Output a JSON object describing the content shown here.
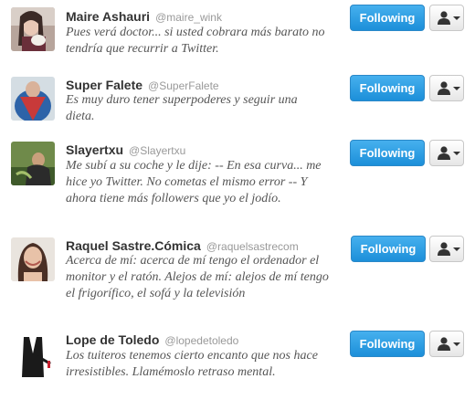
{
  "follow_label": "Following",
  "users": [
    {
      "name": "Maire Ashauri",
      "handle": "@maire_wink",
      "bio": "Pues verá doctor... si usted cobrara más barato no tendría que recurrir a Twitter."
    },
    {
      "name": "Super Falete",
      "handle": "@SuperFalete",
      "bio": "Es muy duro tener superpoderes y seguir una dieta."
    },
    {
      "name": "Slayertxu",
      "handle": "@Slayertxu",
      "bio": "Me subí a su coche y le dije: -- En esa curva... me hice yo Twitter. No cometas el mismo error -- Y ahora tiene más followers que yo el jodío."
    },
    {
      "name": "Raquel Sastre.Cómica",
      "handle": "@raquelsastrecom",
      "bio": "Acerca de mí: acerca de mí tengo el ordenador el monitor y el ratón. Alejos de mí: alejos de mí tengo el frigorífico, el sofá y la televisión"
    },
    {
      "name": "Lope de Toledo",
      "handle": "@lopedetoledo",
      "bio": "Los tuiteros tenemos cierto encanto que nos hace irresistibles. Llamémoslo retraso mental."
    }
  ]
}
